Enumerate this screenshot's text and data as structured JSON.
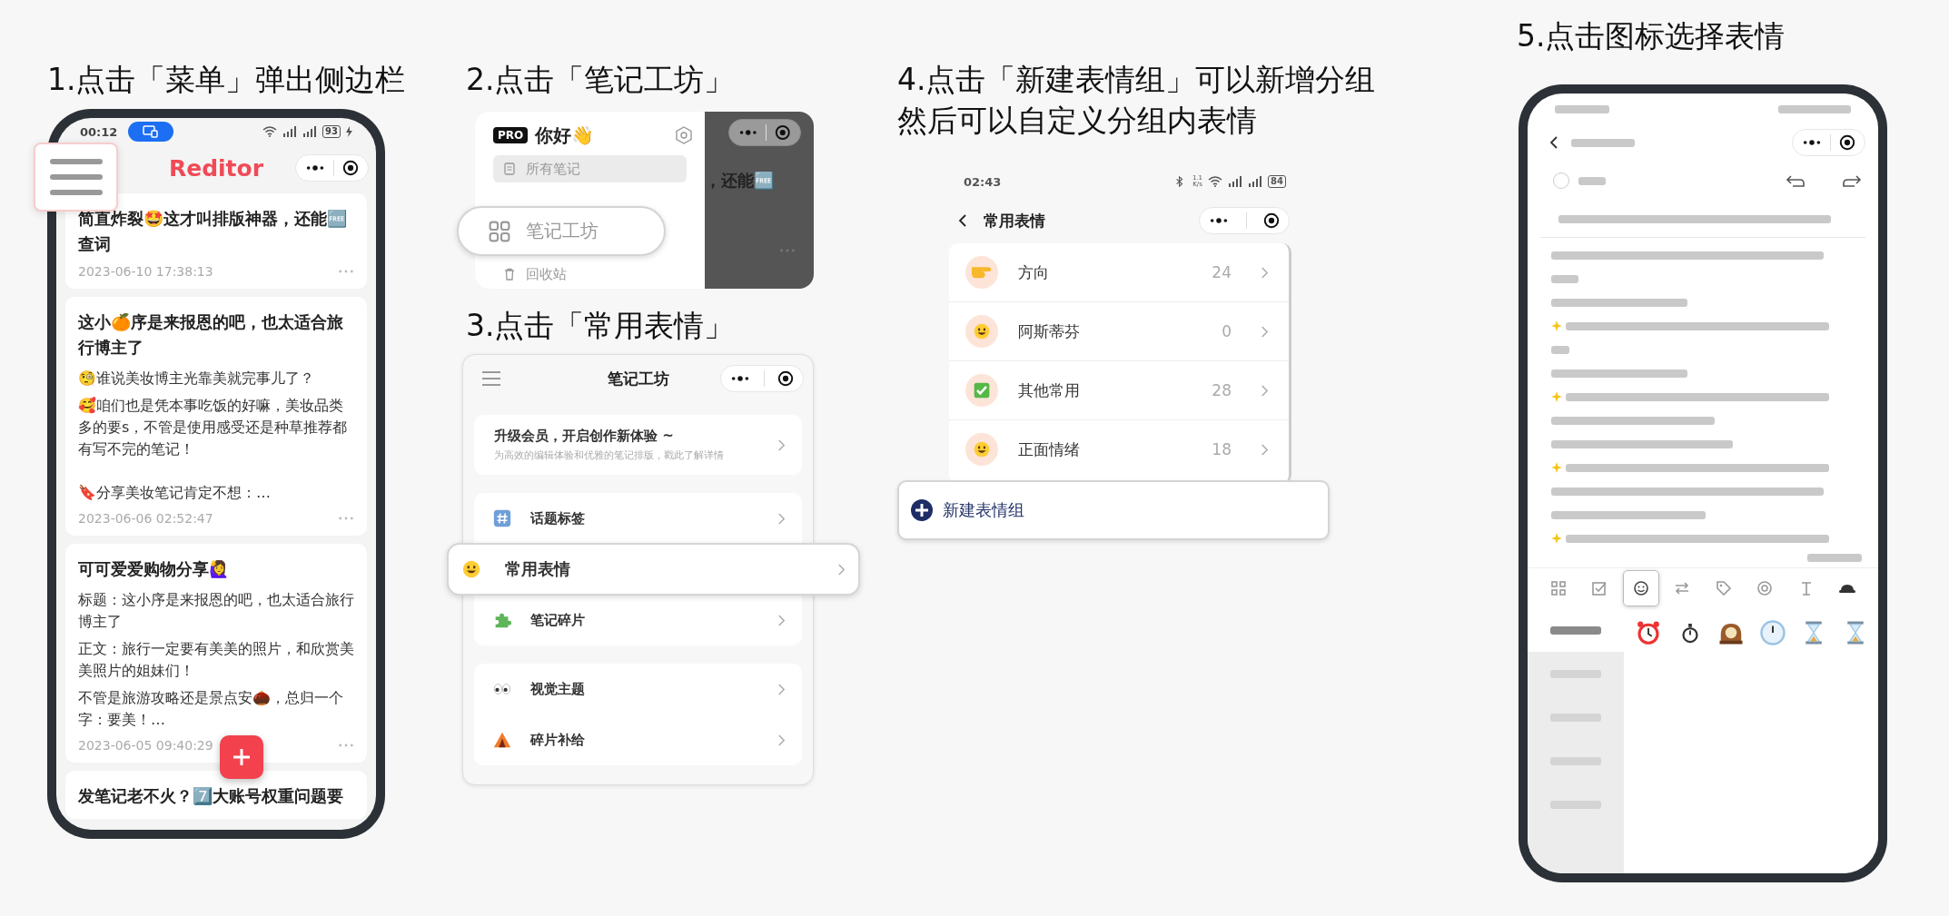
{
  "step1": {
    "title": "1.点击「菜单」弹出侧边栏",
    "status_bar": {
      "time": "00:12",
      "battery": "93"
    },
    "app_title": "Reditor",
    "notes": [
      {
        "title": "简直炸裂🤩这才叫排版神器，还能🆓查词",
        "date": "2023-06-10 17:38:13"
      },
      {
        "title": "这小🍊序是来报恩的吧，也太适合旅行博主了",
        "body": [
          "🧐谁说美妆博主光靠美就完事儿了？",
          "🥰咱们也是凭本事吃饭的好嘛，美妆品类多的要s，不管是使用感受还是种草推荐都有写不完的笔记！"
        ],
        "excerpt": "🔖分享美妆笔记肯定不想：…",
        "date": "2023-06-06 02:52:47"
      },
      {
        "title": "可可爱爱购物分享🙋‍♀️",
        "body": [
          "标题：这小序是来报恩的吧，也太适合旅行博主了",
          "正文：旅行一定要有美美的照片，和欣赏美美照片的姐妹们！",
          "不管是旅游攻略还是景点安🌰，总归一个字：要美！…"
        ],
        "date": "2023-06-05 09:40:29"
      },
      {
        "title": "发笔记老不火？7️⃣大账号权重问题要"
      }
    ]
  },
  "step2": {
    "title": "2.点击「笔记工坊」",
    "sidebar": {
      "badge": "PRO",
      "greeting": "你好👋",
      "items": [
        {
          "kind": "note",
          "label": "所有笔记",
          "selected": true,
          "highlighted": false
        },
        {
          "kind": "grid",
          "label": "笔记工坊",
          "selected": false,
          "highlighted": true
        },
        {
          "kind": "trash",
          "label": "回收站",
          "selected": false,
          "highlighted": false
        }
      ]
    },
    "background_note": "，还能🆓"
  },
  "step3": {
    "title": "3.点击「常用表情」",
    "page_title": "笔记工坊",
    "promo": {
      "title": "升级会员，开启创作新体验 ~",
      "subtitle": "为高效的编辑体验和优雅的笔记排版，戳此了解详情"
    },
    "groups": [
      {
        "items": [
          {
            "kind": "hash",
            "label": "话题标签",
            "highlighted": false
          },
          {
            "kind": "smiley",
            "label": "常用表情",
            "highlighted": true
          },
          {
            "kind": "puzzle",
            "label": "笔记碎片",
            "highlighted": false
          }
        ]
      },
      {
        "items": [
          {
            "kind": "eyes",
            "label": "视觉主题",
            "highlighted": false
          },
          {
            "kind": "tent",
            "label": "碎片补给",
            "highlighted": false
          }
        ]
      }
    ]
  },
  "step4": {
    "title_lines": [
      "4.点击「新建表情组」可以新增分组",
      "然后可以自定义分组内表情"
    ],
    "status_bar": {
      "time": "02:43",
      "net_speed": "1.1\nK/s",
      "battery": "84"
    },
    "page_title": "常用表情",
    "emoji_groups": [
      {
        "kind": "pointing",
        "label": "方向",
        "count": "24"
      },
      {
        "kind": "smiley",
        "label": "阿斯蒂芬",
        "count": "0"
      },
      {
        "kind": "check",
        "label": "其他常用",
        "count": "28"
      },
      {
        "kind": "smiley",
        "label": "正面情绪",
        "count": "18"
      }
    ],
    "new_group_button": "新建表情组"
  },
  "step5": {
    "title": "5.点击图标选择表情",
    "tool_tabs": [
      {
        "kind": "grid",
        "selected": false
      },
      {
        "kind": "checkbox",
        "selected": false
      },
      {
        "kind": "emoji",
        "selected": true
      },
      {
        "kind": "shuffle",
        "selected": false
      },
      {
        "kind": "tag",
        "selected": false
      },
      {
        "kind": "at",
        "selected": false
      },
      {
        "kind": "text",
        "selected": false
      },
      {
        "kind": "hat",
        "selected": false
      }
    ],
    "categories": [
      {
        "selected": true
      },
      {
        "selected": false
      },
      {
        "selected": false
      },
      {
        "selected": false
      },
      {
        "selected": false
      }
    ],
    "emojis": [
      {
        "kind": "alarm-clock"
      },
      {
        "kind": "stopwatch"
      },
      {
        "kind": "mantel-clock"
      },
      {
        "kind": "clock"
      },
      {
        "kind": "hourglass"
      },
      {
        "kind": "hourglass"
      }
    ]
  }
}
